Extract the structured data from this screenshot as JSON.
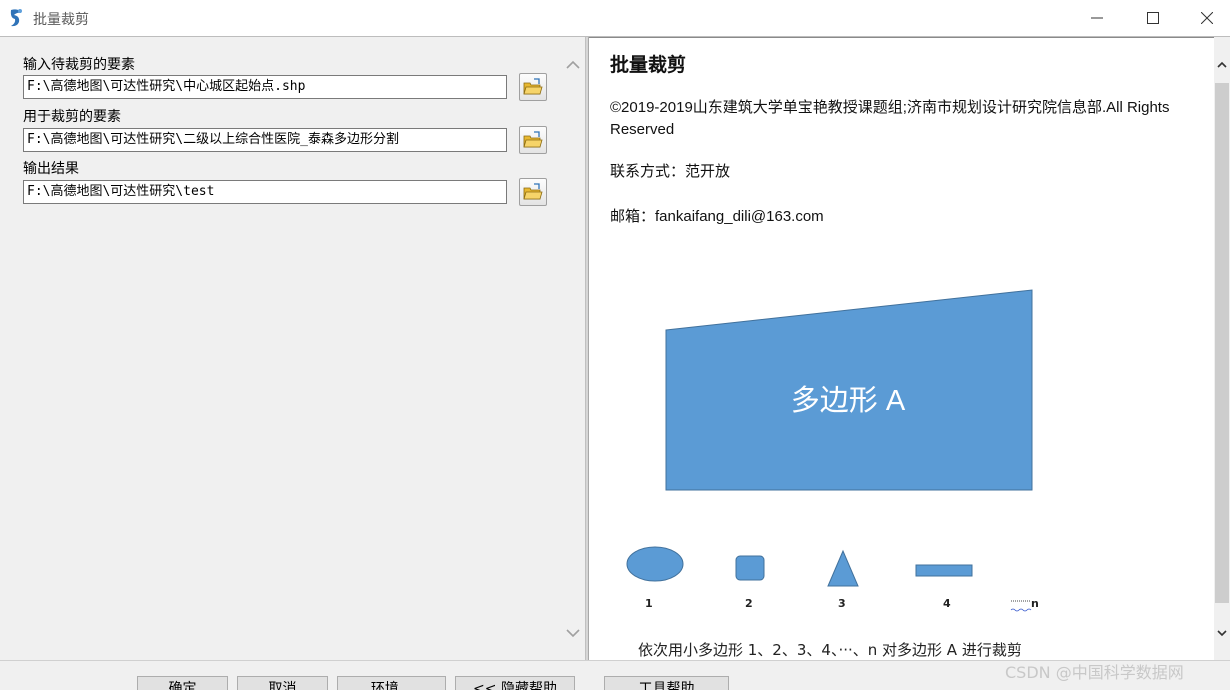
{
  "window": {
    "title": "批量裁剪",
    "icon": "arcgis-toolbox-icon",
    "controls": [
      "minimize-icon",
      "maximize-icon",
      "close-icon"
    ]
  },
  "form": {
    "fields": [
      {
        "label": "输入待裁剪的要素",
        "value": "F:\\高德地图\\可达性研究\\中心城区起始点.shp",
        "browse_icon": "open-folder-icon"
      },
      {
        "label": "用于裁剪的要素",
        "value": "F:\\高德地图\\可达性研究\\二级以上综合性医院_泰森多边形分割",
        "browse_icon": "open-folder-icon"
      },
      {
        "label": "输出结果",
        "value": "F:\\高德地图\\可达性研究\\test",
        "browse_icon": "open-folder-icon"
      }
    ]
  },
  "help": {
    "title": "批量裁剪",
    "copyright": "©2019-2019山东建筑大学单宝艳教授课题组;济南市规划设计研究院信息部.All Rights Reserved",
    "contact": "联系方式：范开放",
    "email": "邮箱：fankaifang_dili@163.com",
    "diagram": {
      "polygon_label": "多边形 A",
      "shape_labels": [
        "1",
        "2",
        "3",
        "4",
        "n"
      ],
      "caption": "依次用小多边形 1、2、3、4、···、n 对多边形 A 进行裁剪",
      "fill_color": "#5b9bd5"
    }
  },
  "buttons": {
    "ok": "确定",
    "cancel": "取消",
    "environments": "环境...",
    "hide_help": "<< 隐藏帮助",
    "tool_help": "工具帮助"
  },
  "watermark": "CSDN @中国科学数据网"
}
